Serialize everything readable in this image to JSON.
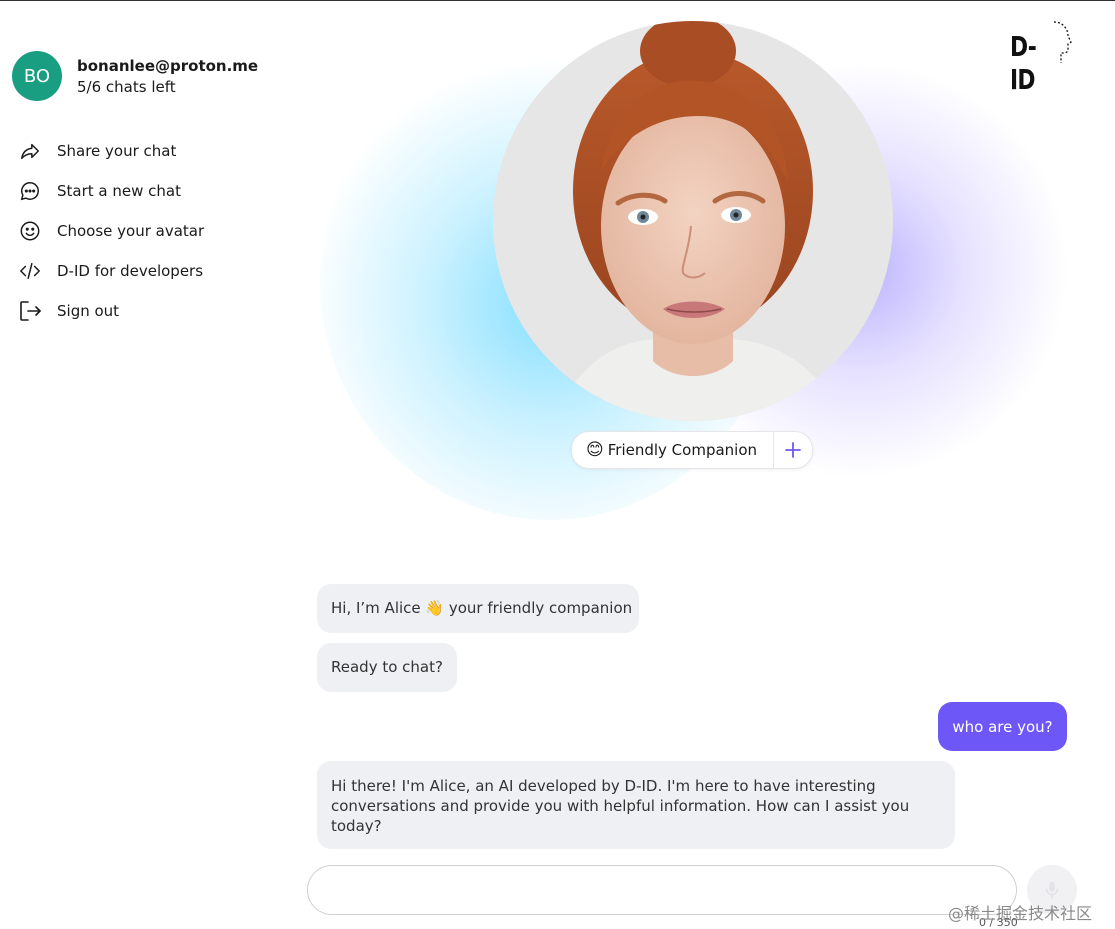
{
  "user": {
    "initials": "BO",
    "email": "bonanlee@proton.me",
    "chats_left": "5/6 chats left"
  },
  "menu": [
    {
      "label": "Share your chat",
      "icon": "share-icon"
    },
    {
      "label": "Start a new chat",
      "icon": "chat-bubble-icon"
    },
    {
      "label": "Choose your avatar",
      "icon": "smiley-icon"
    },
    {
      "label": "D-ID for developers",
      "icon": "code-icon"
    },
    {
      "label": "Sign out",
      "icon": "sign-out-icon"
    }
  ],
  "logo": {
    "text": "D-ID"
  },
  "companion": {
    "emoji": "😊",
    "label": "Friendly Companion",
    "add_icon": "plus-icon"
  },
  "messages": [
    {
      "from": "assistant",
      "text": "Hi, I’m Alice 👋 your friendly companion"
    },
    {
      "from": "assistant",
      "text": "Ready to chat?"
    },
    {
      "from": "user",
      "text": "who are you?"
    },
    {
      "from": "assistant",
      "text": "Hi there! I'm Alice, an AI developed by D-ID. I'm here to have interesting conversations and provide you with helpful information. How can I assist you today?"
    }
  ],
  "input": {
    "value": "",
    "placeholder": "",
    "counter": "0 / 350"
  },
  "mic_icon": "microphone-icon",
  "watermark": "@稀土掘金技术社区",
  "colors": {
    "accent": "#6d57f6",
    "avatar_bg": "#1a9e82",
    "bubble_bg": "#eff0f3"
  }
}
